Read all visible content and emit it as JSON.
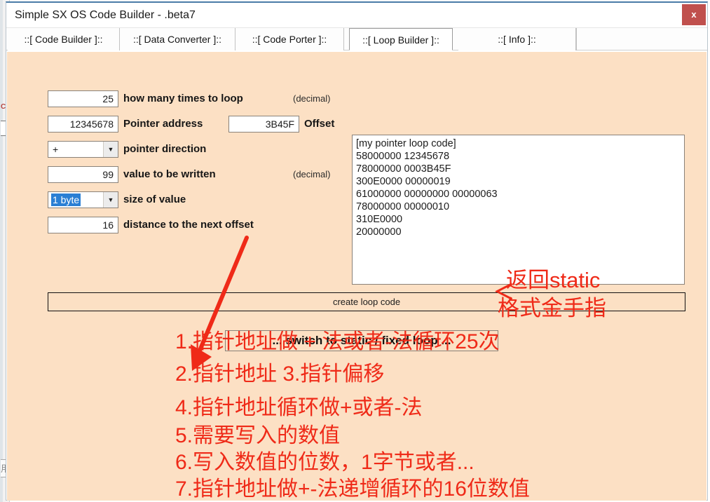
{
  "window": {
    "title": "Simple SX OS Code Builder - .beta7",
    "close_label": "x"
  },
  "tabs": [
    {
      "label": "::[ Code Builder ]::",
      "active": false
    },
    {
      "label": "::[ Data Converter ]::",
      "active": false
    },
    {
      "label": "::[ Code Porter ]::",
      "active": false
    },
    {
      "label": "::[ Loop Builder ]::",
      "active": true
    },
    {
      "label": "::[ Info ]::",
      "active": false
    }
  ],
  "form": {
    "loop_count": {
      "value": "25",
      "label": "how many times to loop",
      "note": "(decimal)"
    },
    "pointer_address": {
      "value": "12345678",
      "label": "Pointer address"
    },
    "offset": {
      "value": "3B45F",
      "label": "Offset"
    },
    "pointer_direction": {
      "value": "+",
      "label": "pointer direction"
    },
    "value_written": {
      "value": "99",
      "label": "value to be written",
      "note": "(decimal)"
    },
    "size_of_value": {
      "value": "1 byte",
      "label": "size of value"
    },
    "distance_next_offset": {
      "value": "16",
      "label": "distance to the next offset"
    }
  },
  "code_output": {
    "lines": [
      "[my pointer loop code]",
      "58000000 12345678",
      "78000000 0003B45F",
      "300E0000 00000019",
      "61000000 00000000 00000063",
      "78000000 00000010",
      "310E0000",
      "20000000"
    ]
  },
  "buttons": {
    "create_loop_code": "create loop code",
    "switch_static": "... switch to static / fixed loop ..."
  },
  "annotations": {
    "static_marker": "＜",
    "static_line1": "返回static",
    "static_line2": "格式金手指",
    "notes": [
      "1.指针地址做 + 法或者-法循环25次",
      "2.指针地址  3.指针偏移",
      "4.指针地址循环做+或者-法",
      "5.需要写入的数值",
      "6.写入数值的位数，1字节或者...",
      "7.指针地址做+-法递增循环的16位数值"
    ]
  },
  "colors": {
    "panel_background": "#fce0c4",
    "annotation_red": "#ef2a18",
    "close_button": "#c0504d",
    "selection_blue": "#2a7fd4"
  }
}
